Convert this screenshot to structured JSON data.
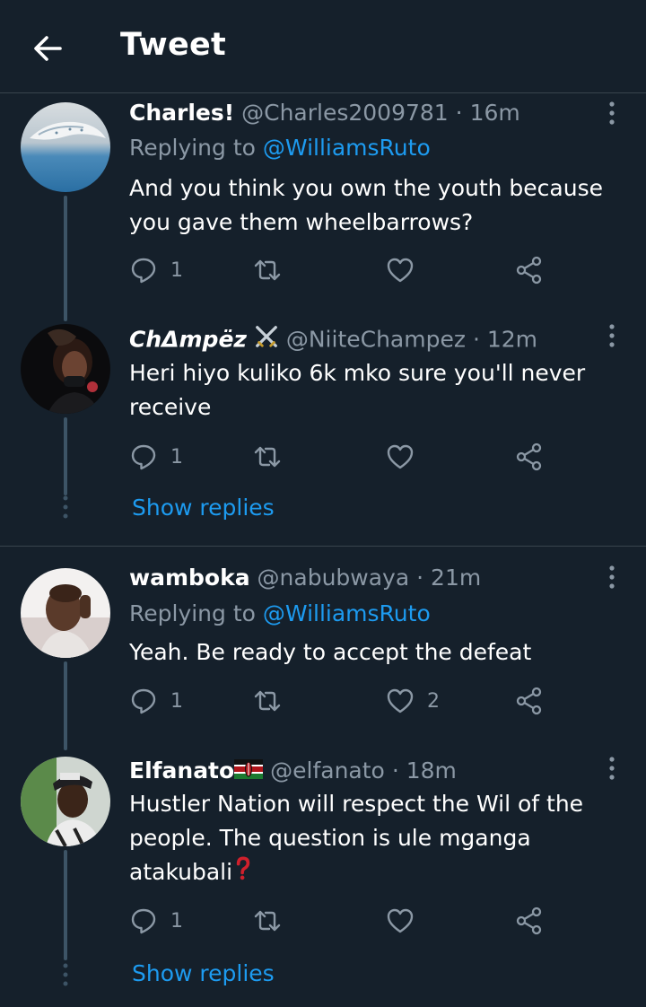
{
  "header": {
    "title": "Tweet"
  },
  "tweets": [
    {
      "name": "Charles!",
      "handle": "@Charles2009781",
      "dot": "·",
      "time": "16m",
      "replying_prefix": "Replying to",
      "replying_to": "@WilliamsRuto",
      "text": "And you think you own the youth because you gave them wheelbarrows?",
      "reply_count": "1",
      "retweet_count": "",
      "like_count": ""
    },
    {
      "name": "ChΔmpëz",
      "handle": "@NiiteChampez",
      "dot": "·",
      "time": "12m",
      "text": "Heri hiyo kuliko 6k mko sure you'll never receive",
      "reply_count": "1",
      "retweet_count": "",
      "like_count": ""
    },
    {
      "name": "wamboka",
      "handle": "@nabubwaya",
      "dot": "·",
      "time": "21m",
      "replying_prefix": "Replying to",
      "replying_to": "@WilliamsRuto",
      "text": "Yeah. Be ready to accept the defeat",
      "reply_count": "1",
      "retweet_count": "",
      "like_count": "2"
    },
    {
      "name": "Elfanato",
      "handle": "@elfanato",
      "dot": "·",
      "time": "18m",
      "text": "Hustler Nation will respect the Wil of the people. The question is ule mganga atakubali",
      "reply_count": "1",
      "retweet_count": "",
      "like_count": ""
    }
  ],
  "show_replies_label": "Show replies",
  "icons": {
    "back": "arrow-left-icon",
    "more": "more-vertical-icon",
    "reply": "reply-bubble-icon",
    "retweet": "retweet-icon",
    "like": "heart-icon",
    "share": "share-icon"
  },
  "colors": {
    "background": "#15202b",
    "accent": "#1d9bf0",
    "muted": "#8b98a5",
    "divider": "#38444d"
  }
}
